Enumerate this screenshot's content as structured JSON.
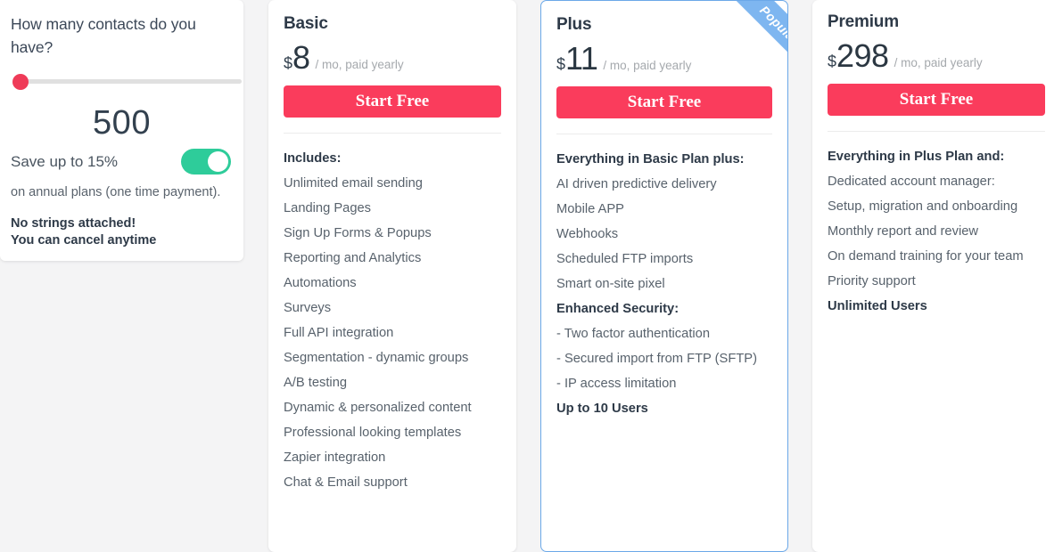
{
  "calculator": {
    "question": "How many contacts do you have?",
    "slider": {
      "value": 500,
      "position_percent": 0,
      "handle_color": "#ef3b58",
      "track_color": "#e0e0e0"
    },
    "count_display": "500",
    "save_label": "Save up to 15%",
    "toggle": {
      "state": "on",
      "color": "#2ecc9a"
    },
    "annual_note": "on annual plans (one time payment).",
    "no_strings_line1": "No strings attached!",
    "no_strings_line2": "You can cancel anytime"
  },
  "plans": [
    {
      "name": "Basic",
      "currency": "$",
      "amount": "8",
      "period": "/ mo, paid yearly",
      "cta": "Start Free",
      "features": [
        {
          "text": "Includes:",
          "bold": true
        },
        {
          "text": "Unlimited email sending",
          "bold": false
        },
        {
          "text": "Landing Pages",
          "bold": false
        },
        {
          "text": "Sign Up Forms & Popups",
          "bold": false
        },
        {
          "text": "Reporting and Analytics",
          "bold": false
        },
        {
          "text": "Automations",
          "bold": false
        },
        {
          "text": "Surveys",
          "bold": false
        },
        {
          "text": "Full API integration",
          "bold": false
        },
        {
          "text": "Segmentation - dynamic groups",
          "bold": false
        },
        {
          "text": "A/B testing",
          "bold": false
        },
        {
          "text": "Dynamic & personalized content",
          "bold": false
        },
        {
          "text": "Professional looking templates",
          "bold": false
        },
        {
          "text": "Zapier integration",
          "bold": false
        },
        {
          "text": "Chat & Email support",
          "bold": false
        }
      ],
      "badge": null,
      "highlighted": false
    },
    {
      "name": "Plus",
      "currency": "$",
      "amount": "11",
      "period": "/ mo, paid yearly",
      "cta": "Start Free",
      "features": [
        {
          "text": "Everything in Basic Plan plus:",
          "bold": true
        },
        {
          "text": "AI driven predictive delivery",
          "bold": false
        },
        {
          "text": "Mobile APP",
          "bold": false
        },
        {
          "text": "Webhooks",
          "bold": false
        },
        {
          "text": "Scheduled FTP imports",
          "bold": false
        },
        {
          "text": "Smart on-site pixel",
          "bold": false
        },
        {
          "text": "Enhanced Security:",
          "bold": true
        },
        {
          "text": "- Two factor authentication",
          "bold": false
        },
        {
          "text": "- Secured import from FTP (SFTP)",
          "bold": false
        },
        {
          "text": "- IP access limitation",
          "bold": false
        },
        {
          "text": "Up to 10 Users",
          "bold": true
        }
      ],
      "badge": "Popular",
      "highlighted": true
    },
    {
      "name": "Premium",
      "currency": "$",
      "amount": "298",
      "period": "/ mo, paid yearly",
      "cta": "Start Free",
      "features": [
        {
          "text": "Everything in Plus Plan and:",
          "bold": true
        },
        {
          "text": "Dedicated account manager:",
          "bold": false
        },
        {
          "text": "Setup, migration and onboarding",
          "bold": false
        },
        {
          "text": "Monthly report and review",
          "bold": false
        },
        {
          "text": "On demand training for your team",
          "bold": false
        },
        {
          "text": "Priority support",
          "bold": false
        },
        {
          "text": "Unlimited Users",
          "bold": true
        }
      ],
      "badge": null,
      "highlighted": false
    }
  ],
  "colors": {
    "accent_red": "#fa3c5c",
    "accent_green": "#2ecc9a",
    "ribbon_blue": "#7eb6f0",
    "highlight_border": "#6ba8e8",
    "page_background": "#f4f4f5"
  }
}
